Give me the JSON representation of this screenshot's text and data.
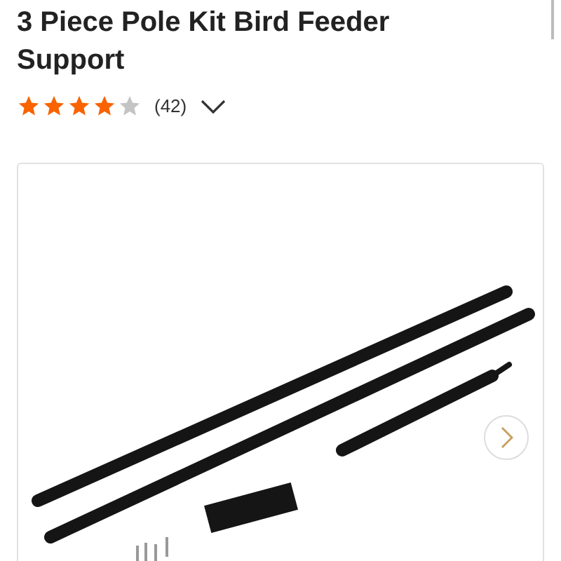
{
  "product": {
    "title": "3 Piece Pole Kit Bird Feeder Support",
    "stars": 4,
    "review_count": "(42)"
  }
}
